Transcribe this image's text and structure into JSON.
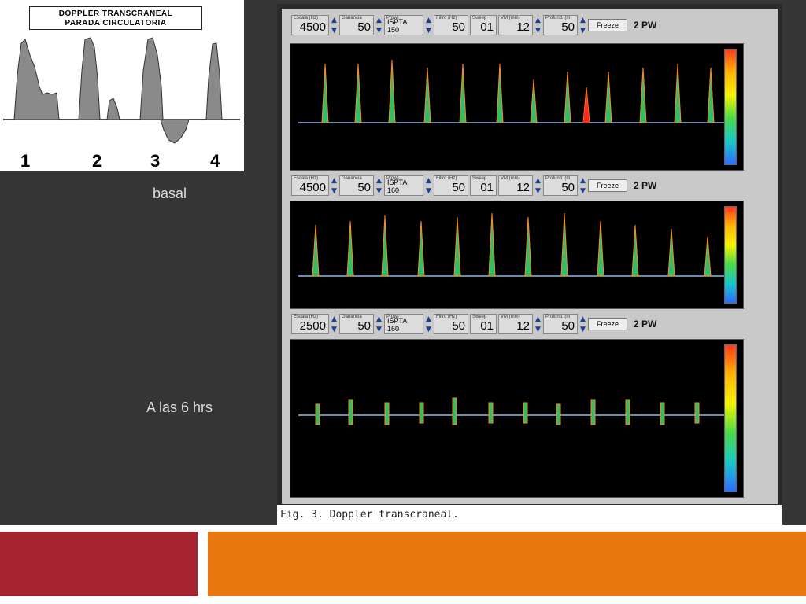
{
  "schema": {
    "title_line1": "DOPPLER TRANSCRANEAL",
    "title_line2": "PARADA CIRCULATORIA",
    "numbers": [
      "1",
      "2",
      "3",
      "4"
    ]
  },
  "labels": {
    "basal": "basal",
    "six_hrs": "A las 6 hrs"
  },
  "panels": [
    {
      "escala": "4500",
      "ganancia": "50",
      "ispta": "ISPTA 150",
      "filtro": "50",
      "sweep": "01",
      "vm": "12",
      "profund": "50",
      "freeze": "Freeze",
      "mode": "2 PW"
    },
    {
      "escala": "4500",
      "ganancia": "50",
      "ispta": "ISPTA 160",
      "filtro": "50",
      "sweep": "01",
      "vm": "12",
      "profund": "50",
      "freeze": "Freeze",
      "mode": "2 PW"
    },
    {
      "escala": "2500",
      "ganancia": "50",
      "ispta": "ISPTA 160",
      "filtro": "50",
      "sweep": "01",
      "vm": "12",
      "profund": "50",
      "freeze": "Freeze",
      "mode": "2 PW"
    }
  ],
  "control_captions": {
    "escala": "Escala (Hz)",
    "ganancia": "Ganancia",
    "power": "P(pw)",
    "filtro": "Filtro (Hz)",
    "sweep": "Sweep",
    "vm": "VM (mm)",
    "profund": "Profund. (m"
  },
  "caption": "Fig. 3. Doppler transcraneal.",
  "colors": {
    "background": "#363636",
    "band_red": "#a5242f",
    "band_orange": "#e8770f"
  }
}
